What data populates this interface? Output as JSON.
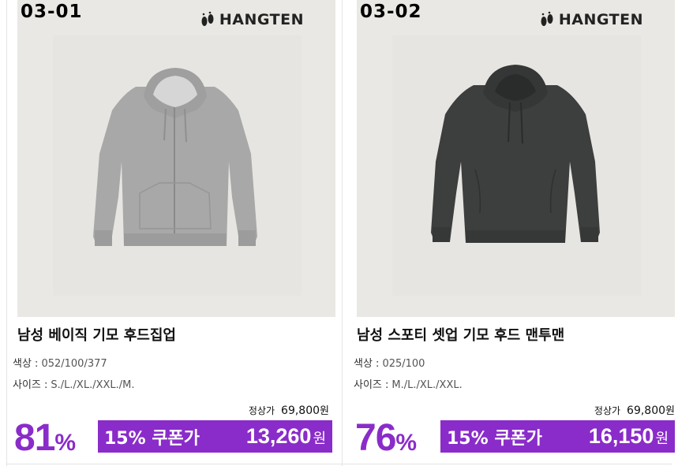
{
  "products": [
    {
      "code": "03-01",
      "brand": "HANGTEN",
      "title": "남성 베이직 기모 후드집업",
      "color_label": "색상 :",
      "color_value": "052/100/377",
      "size_label": "사이즈 :",
      "size_value": "S./L./XL./XXL./M.",
      "regular_label": "정상가",
      "regular_price": "69,800",
      "regular_unit": "원",
      "discount": "81",
      "discount_unit": "%",
      "coupon_label": "15% 쿠폰가",
      "coupon_price": "13,260",
      "coupon_unit": "원",
      "garment_color": "#a7a7a7"
    },
    {
      "code": "03-02",
      "brand": "HANGTEN",
      "title": "남성 스포티 셋업 기모 후드 맨투맨",
      "color_label": "색상 :",
      "color_value": "025/100",
      "size_label": "사이즈 :",
      "size_value": "M./L./XL./XXL.",
      "regular_label": "정상가",
      "regular_price": "69,800",
      "regular_unit": "원",
      "discount": "76",
      "discount_unit": "%",
      "coupon_label": "15% 쿠폰가",
      "coupon_price": "16,150",
      "coupon_unit": "원",
      "garment_color": "#3e3f3f"
    }
  ],
  "accent_color": "#8a2cc9"
}
